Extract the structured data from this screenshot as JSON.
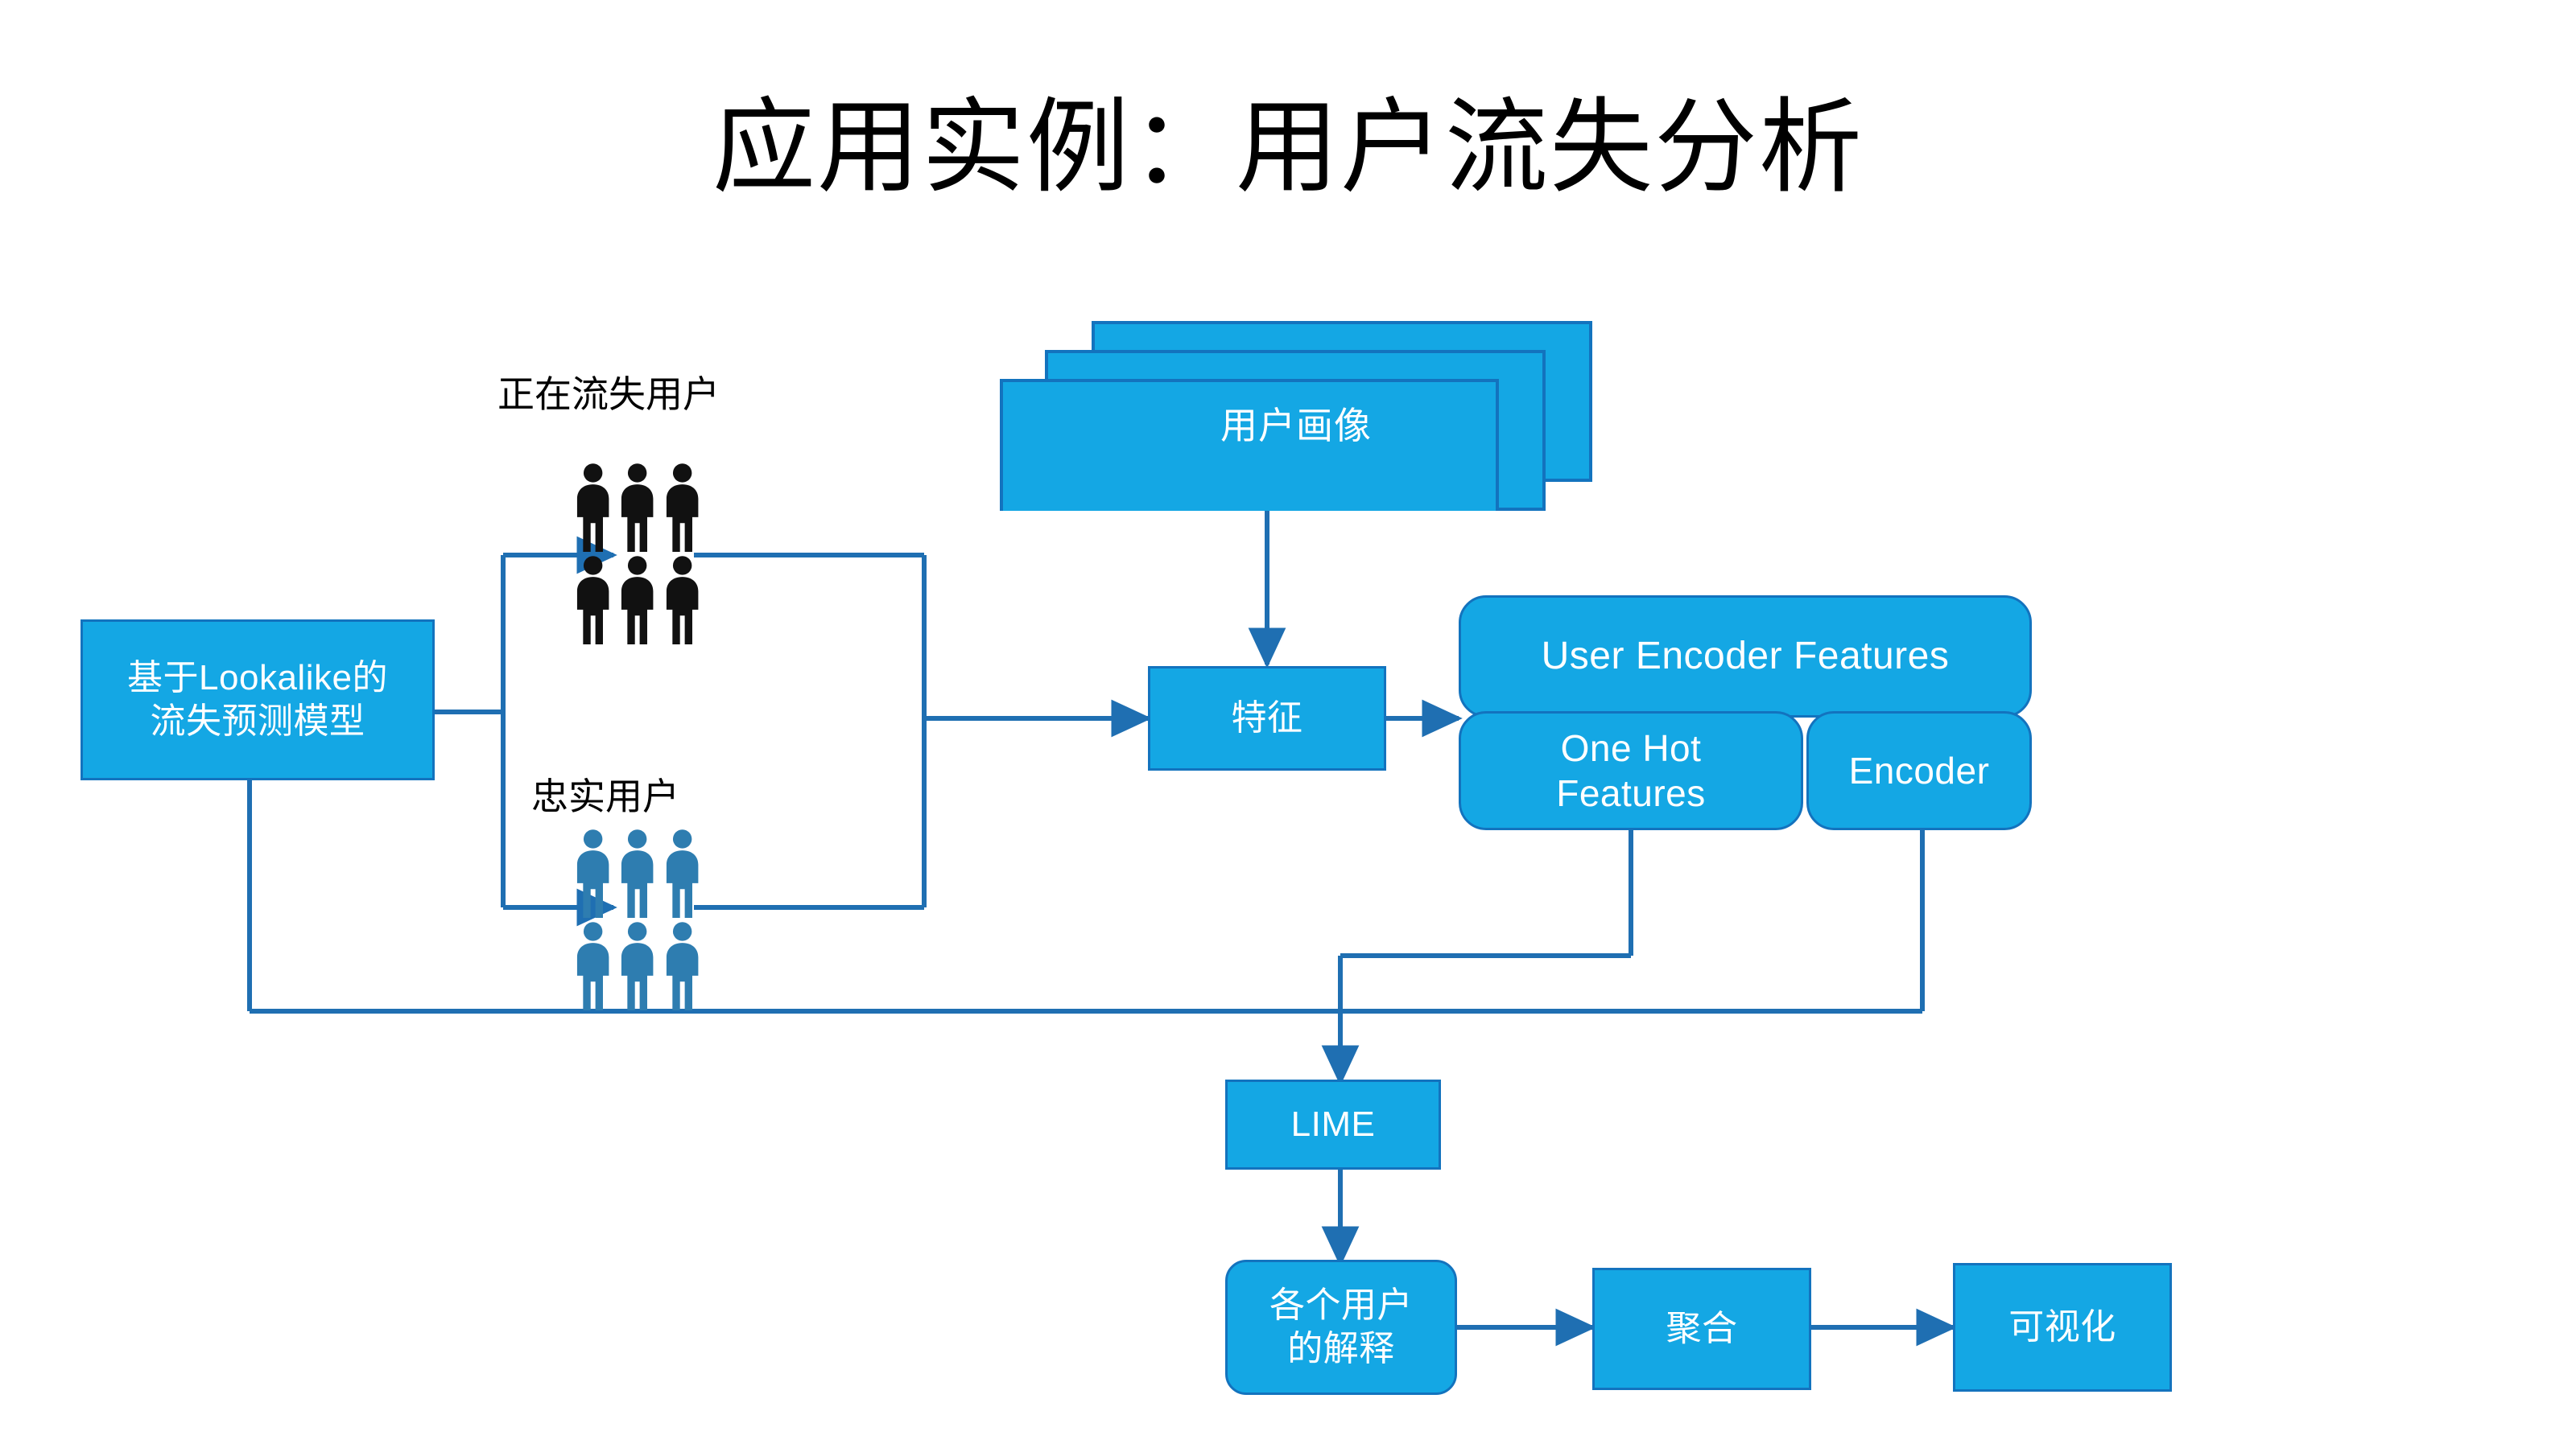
{
  "slide": {
    "title": "应用实例：用户流失分析",
    "background": "#FFFFFF",
    "accent_fill": "#14A7E4",
    "accent_stroke": "#1373BE",
    "connector_color": "#1F6FB2",
    "label_color": "#000000",
    "people_churn_color": "#111111",
    "people_loyal_color": "#2E7DB0"
  },
  "labels": {
    "churning_users": "正在流失用户",
    "loyal_users": "忠实用户"
  },
  "people": {
    "churning": {
      "count": 6,
      "rows": 2,
      "cols": 3,
      "color": "#111111"
    },
    "loyal": {
      "count": 6,
      "rows": 2,
      "cols": 3,
      "color": "#2E7DB0"
    }
  },
  "nodes": {
    "model": {
      "text": "基于Lookalike的\n流失预测模型"
    },
    "user_profile": {
      "text": "用户画像"
    },
    "features": {
      "text": "特征"
    },
    "user_encoder": {
      "text": "User Encoder Features"
    },
    "one_hot": {
      "text": "One Hot\nFeatures"
    },
    "encoder": {
      "text": "Encoder"
    },
    "lime": {
      "text": "LIME"
    },
    "per_user": {
      "text": "各个用户\n的解释"
    },
    "aggregate": {
      "text": "聚合"
    },
    "visualize": {
      "text": "可视化"
    }
  }
}
